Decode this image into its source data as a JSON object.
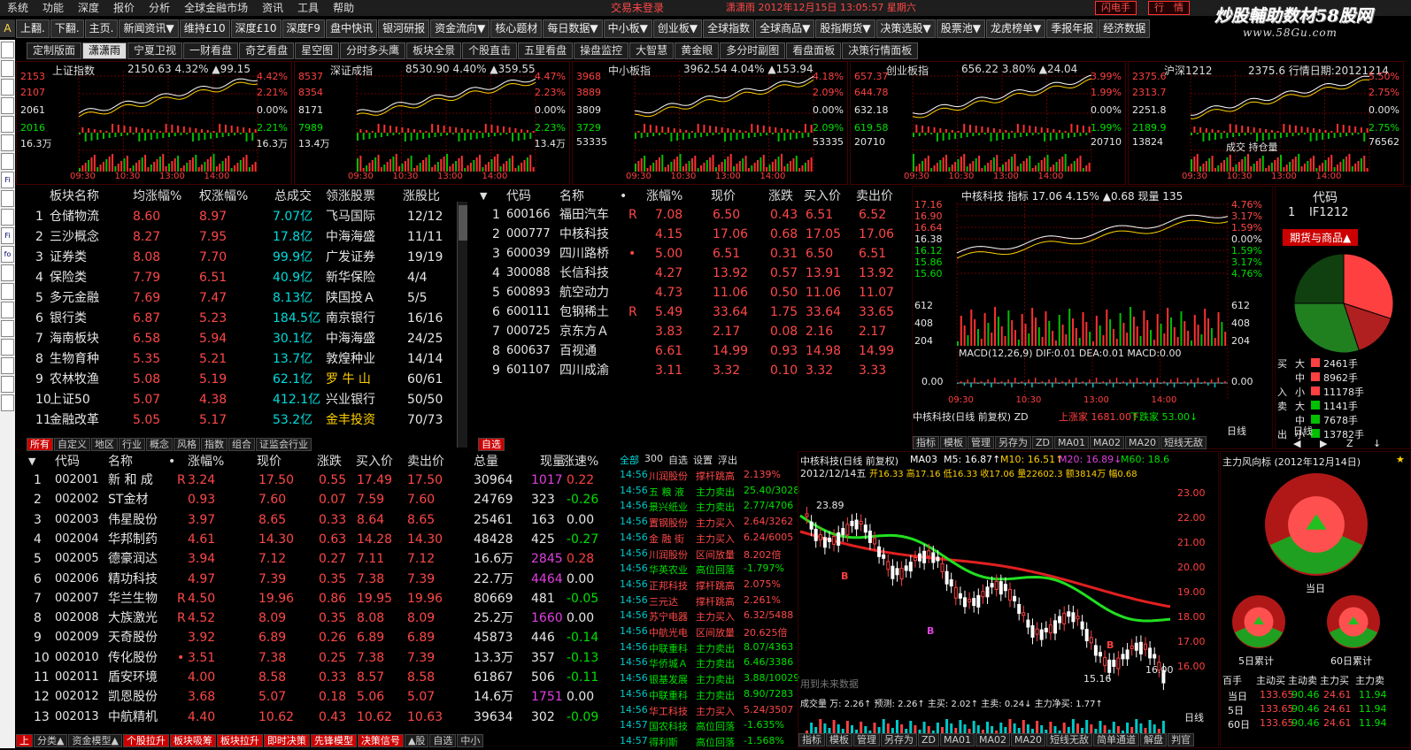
{
  "menu": [
    "系统",
    "功能",
    "深度",
    "报价",
    "分析",
    "全球金融市场",
    "资讯",
    "工具",
    "帮助"
  ],
  "status": {
    "trade": "交易未登录",
    "info": "潇潇雨  2012年12月15日  13:05:57  星期六"
  },
  "top_buttons": {
    "flash": "闪电手",
    "trade": "行　情"
  },
  "watermark": {
    "line1": "炒股輔助数材58股网",
    "line2": "www.58Gu.com"
  },
  "toolbar": [
    "上翻.",
    "下翻.",
    "主页.",
    "新闻资讯▼",
    "维持£10",
    "深度£10",
    "深度F9",
    "盘中快讯",
    "银河研报",
    "资金流向▼",
    "核心题材",
    "每日数据▼",
    "中小板▼",
    "创业板▼",
    "全球指数",
    "全球商品▼",
    "股指期货▼",
    "决策选股▼",
    "股票池▼",
    "龙虎榜单▼",
    "季报年报",
    "经济数据"
  ],
  "side_letter": "A",
  "side_tools": [
    "",
    "",
    "",
    "",
    "",
    "",
    "",
    "Fi",
    "",
    "",
    "Fi",
    "fo",
    "",
    "",
    "",
    "",
    "",
    "",
    "",
    ""
  ],
  "tabs": {
    "items": [
      "定制版面",
      "潇潇雨",
      "宁夏卫视",
      "一财看盘",
      "奇艺看盘",
      "星空图",
      "分时多头鹰",
      "板块全景",
      "个股直击",
      "五里看盘",
      "操盘监控",
      "大智慧",
      "黄金眼",
      "多分时副图",
      "看盘面板",
      "决策行情面板"
    ],
    "active": 1
  },
  "minis": [
    {
      "title": "上证指数",
      "head": "2150.63  4.32%  ▲99.15",
      "left": [
        "2153",
        "2107",
        "2061",
        "2016",
        "16.3万"
      ],
      "right": [
        "4.42%",
        "2.21%",
        "0.00%",
        "2.21%",
        "16.3万"
      ],
      "times": [
        "09:30",
        "10:30",
        "13:00",
        "14:00"
      ]
    },
    {
      "title": "深证成指",
      "head": "8530.90  4.40%  ▲359.55",
      "left": [
        "8537",
        "8354",
        "8171",
        "7989",
        "13.4万"
      ],
      "right": [
        "4.47%",
        "2.23%",
        "0.00%",
        "2.23%",
        "13.4万"
      ],
      "times": [
        "09:30",
        "10:30",
        "13:00",
        "14:00"
      ]
    },
    {
      "title": "中小板指",
      "head": "3962.54  4.04%  ▲153.94",
      "left": [
        "3968",
        "3889",
        "3809",
        "3729",
        "53335"
      ],
      "right": [
        "4.18%",
        "2.09%",
        "0.00%",
        "2.09%",
        "53335"
      ],
      "times": [
        "09:30",
        "10:30",
        "13:00",
        "14:00"
      ]
    },
    {
      "title": "创业板指",
      "head": "656.22  3.80%  ▲24.04",
      "left": [
        "657.37",
        "644.78",
        "632.18",
        "619.58",
        "20710"
      ],
      "right": [
        "3.99%",
        "1.99%",
        "0.00%",
        "1.99%",
        "20710"
      ],
      "times": [
        "09:30",
        "10:30",
        "13:00",
        "14:00"
      ]
    },
    {
      "title": "沪深1212",
      "head": "2375.6  行情日期:20121214",
      "left": [
        "2375.6",
        "2313.7",
        "2251.8",
        "2189.9",
        "13824"
      ],
      "right": [
        "5.50%",
        "2.75%",
        "0.00%",
        "2.75%",
        "76562"
      ],
      "times": [
        "09:30",
        "10:30",
        "13:00",
        "14:00"
      ],
      "extra": "成交  持仓量"
    }
  ],
  "sector_table": {
    "headers": [
      "板块名称",
      "均涨幅%",
      "权涨幅%",
      "总成交",
      "领涨股票",
      "涨股比"
    ],
    "rows": [
      [
        "1",
        "仓储物流",
        "8.60",
        "8.97",
        "7.07亿",
        "飞马国际",
        "12/12"
      ],
      [
        "2",
        "三沙概念",
        "8.27",
        "7.95",
        "17.8亿",
        "中海海盛",
        "11/11"
      ],
      [
        "3",
        "证券类",
        "8.08",
        "7.70",
        "99.9亿",
        "广发证券",
        "19/19"
      ],
      [
        "4",
        "保险类",
        "7.79",
        "6.51",
        "40.9亿",
        "新华保险",
        "4/4"
      ],
      [
        "5",
        "多元金融",
        "7.69",
        "7.47",
        "8.13亿",
        "陕国投Ａ",
        "5/5"
      ],
      [
        "6",
        "银行类",
        "6.87",
        "5.23",
        "184.5亿",
        "南京银行",
        "16/16"
      ],
      [
        "7",
        "海南板块",
        "6.58",
        "5.94",
        "30.1亿",
        "中海海盛",
        "24/25"
      ],
      [
        "8",
        "生物育种",
        "5.35",
        "5.21",
        "13.7亿",
        "敦煌种业",
        "14/14"
      ],
      [
        "9",
        "农林牧渔",
        "5.08",
        "5.19",
        "62.1亿",
        "罗 牛 山",
        "60/61"
      ],
      [
        "10",
        "上证50",
        "5.07",
        "4.38",
        "412.1亿",
        "兴业银行",
        "50/50"
      ],
      [
        "11",
        "金融改革",
        "5.05",
        "5.17",
        "53.2亿",
        "金丰投资",
        "70/73"
      ]
    ],
    "tabs": [
      "所有",
      "自定义",
      "地区",
      "行业",
      "概念",
      "风格",
      "指数",
      "组合",
      "证监会行业"
    ]
  },
  "watch_table": {
    "headers": [
      "代码",
      "名称",
      "•",
      "涨幅%",
      "现价",
      "涨跌",
      "买入价",
      "卖出价"
    ],
    "rows": [
      [
        "1",
        "600166",
        "福田汽车",
        "R",
        "7.08",
        "6.50",
        "0.43",
        "6.51",
        "6.52"
      ],
      [
        "2",
        "000777",
        "中核科技",
        "",
        "4.15",
        "17.06",
        "0.68",
        "17.05",
        "17.06"
      ],
      [
        "3",
        "600039",
        "四川路桥",
        "•",
        "5.00",
        "6.51",
        "0.31",
        "6.50",
        "6.51"
      ],
      [
        "4",
        "300088",
        "长信科技",
        "",
        "4.27",
        "13.92",
        "0.57",
        "13.91",
        "13.92"
      ],
      [
        "5",
        "600893",
        "航空动力",
        "",
        "4.73",
        "11.06",
        "0.50",
        "11.06",
        "11.07"
      ],
      [
        "6",
        "600111",
        "包钢稀土",
        "R",
        "5.49",
        "33.64",
        "1.75",
        "33.64",
        "33.65"
      ],
      [
        "7",
        "000725",
        "京东方Ａ",
        "",
        "3.83",
        "2.17",
        "0.08",
        "2.16",
        "2.17"
      ],
      [
        "8",
        "600637",
        "百视通",
        "",
        "6.61",
        "14.99",
        "0.93",
        "14.98",
        "14.99"
      ],
      [
        "9",
        "601107",
        "四川成渝",
        "",
        "3.11",
        "3.32",
        "0.10",
        "3.32",
        "3.33"
      ]
    ],
    "tab": "自选"
  },
  "intraday": {
    "head": "中核科技  指标  17.06  4.15%  ▲0.68  现量 135",
    "left": [
      "17.16",
      "16.90",
      "16.64",
      "16.38",
      "16.12",
      "15.86",
      "15.60",
      "612",
      "408",
      "204"
    ],
    "right": [
      "4.76%",
      "3.17%",
      "1.59%",
      "0.00%",
      "1.59%",
      "3.17%",
      "4.76%",
      "612",
      "408",
      "204"
    ],
    "macd": "MACD(12,26,9)  DIF:0.01  DEA:0.01  MACD:0.00",
    "macd_left": "0.00",
    "macd_right": "0.00",
    "times": [
      "09:30",
      "10:30",
      "13:00",
      "14:00"
    ],
    "foot": "中核科技(日线 前复权) ZD",
    "up": "上涨家  1681.00↑",
    "down": "下跌家  53.00↓",
    "daily": "日线",
    "tools": [
      "指标",
      "模板",
      "管理",
      "另存为",
      "ZD",
      "MA01",
      "MA02",
      "MA20",
      "短线无敌"
    ]
  },
  "futures": {
    "code_hdr": "代码",
    "row_no": "1",
    "row_code": "IF1212",
    "title": "期货与商品▲",
    "flows": [
      [
        "买",
        "大",
        "2461手"
      ],
      [
        "",
        "中",
        "8962手"
      ],
      [
        "入",
        "小",
        "11178手"
      ],
      [
        "卖",
        "大",
        "1141手"
      ],
      [
        "",
        "中",
        "7678手"
      ],
      [
        "出",
        "小",
        "13782手"
      ]
    ],
    "daily": "日线",
    "nav": [
      "◀",
      "▶",
      "Z",
      "↓"
    ]
  },
  "sme_table": {
    "headers": [
      "代码",
      "名称",
      "•",
      "涨幅%",
      "现价",
      "涨跌",
      "买入价",
      "卖出价",
      "总量",
      "现量",
      "涨速%"
    ],
    "rows": [
      [
        "1",
        "002001",
        "新 和 成",
        "R",
        "3.24",
        "17.50",
        "0.55",
        "17.49",
        "17.50",
        "30964",
        "1017",
        "0.22"
      ],
      [
        "2",
        "002002",
        "ST金材",
        "",
        "0.93",
        "7.60",
        "0.07",
        "7.59",
        "7.60",
        "24769",
        "323",
        "-0.26"
      ],
      [
        "3",
        "002003",
        "伟星股份",
        "",
        "3.97",
        "8.65",
        "0.33",
        "8.64",
        "8.65",
        "25461",
        "163",
        "0.00"
      ],
      [
        "4",
        "002004",
        "华邦制药",
        "",
        "4.61",
        "14.30",
        "0.63",
        "14.28",
        "14.30",
        "48428",
        "425",
        "-0.27"
      ],
      [
        "5",
        "002005",
        "德豪润达",
        "",
        "3.94",
        "7.12",
        "0.27",
        "7.11",
        "7.12",
        "16.6万",
        "2845",
        "0.28"
      ],
      [
        "6",
        "002006",
        "精功科技",
        "",
        "4.97",
        "7.39",
        "0.35",
        "7.38",
        "7.39",
        "22.7万",
        "4464",
        "0.00"
      ],
      [
        "7",
        "002007",
        "华兰生物",
        "R",
        "4.50",
        "19.96",
        "0.86",
        "19.95",
        "19.96",
        "80669",
        "481",
        "-0.05"
      ],
      [
        "8",
        "002008",
        "大族激光",
        "R",
        "4.52",
        "8.09",
        "0.35",
        "8.08",
        "8.09",
        "25.2万",
        "1660",
        "0.00"
      ],
      [
        "9",
        "002009",
        "天奇股份",
        "",
        "3.92",
        "6.89",
        "0.26",
        "6.89",
        "6.89",
        "45873",
        "446",
        "-0.14"
      ],
      [
        "10",
        "002010",
        "传化股份",
        "•",
        "3.51",
        "7.38",
        "0.25",
        "7.38",
        "7.39",
        "13.3万",
        "357",
        "-0.13"
      ],
      [
        "11",
        "002011",
        "盾安环境",
        "",
        "4.00",
        "8.58",
        "0.33",
        "8.57",
        "8.58",
        "61867",
        "506",
        "-0.11"
      ],
      [
        "12",
        "002012",
        "凯恩股份",
        "",
        "3.68",
        "5.07",
        "0.18",
        "5.06",
        "5.07",
        "14.6万",
        "1751",
        "0.00"
      ],
      [
        "13",
        "002013",
        "中航精机",
        "",
        "4.40",
        "10.62",
        "0.43",
        "10.62",
        "10.63",
        "39634",
        "302",
        "-0.09"
      ]
    ],
    "tabs": [
      "分类▲",
      "资金模型▲",
      "个股拉升",
      "板块吸筹",
      "板块拉升",
      "即时决策",
      "先锋模型",
      "决策信号",
      "▲股",
      "自选",
      "中小"
    ],
    "left_tab": "上"
  },
  "radar": {
    "header": [
      "全部",
      "300",
      "自选",
      "设置",
      "浮出"
    ],
    "rows": [
      [
        "14:56",
        "川润股份",
        "撑杆跳高",
        "2.139%"
      ],
      [
        "14:56",
        "五 粮 液",
        "主力卖出",
        "25.40/3028"
      ],
      [
        "14:56",
        "景兴纸业",
        "主力卖出",
        "2.77/4706"
      ],
      [
        "14:56",
        "置钢股份",
        "主力买入",
        "2.64/3262"
      ],
      [
        "14:56",
        "金 融 街",
        "主力买入",
        "6.24/6005"
      ],
      [
        "14:56",
        "川润股份",
        "区间放量",
        "8.202倍"
      ],
      [
        "14:56",
        "华英农业",
        "高位回落",
        "-1.797%"
      ],
      [
        "14:56",
        "正邦科技",
        "撑杆跳高",
        "2.075%"
      ],
      [
        "14:56",
        "三元达",
        "撑杆跳高",
        "2.261%"
      ],
      [
        "14:56",
        "苏宁电器",
        "主力买入",
        "6.32/5488"
      ],
      [
        "14:56",
        "中航光电",
        "区间放量",
        "20.625倍"
      ],
      [
        "14:56",
        "中联重科",
        "主力卖出",
        "8.07/4363"
      ],
      [
        "14:56",
        "华侨城Ａ",
        "主力卖出",
        "6.46/3386"
      ],
      [
        "14:56",
        "银基发展",
        "主力卖出",
        "3.88/10029"
      ],
      [
        "14:56",
        "中联重科",
        "主力卖出",
        "8.90/7283"
      ],
      [
        "14:56",
        "华工科技",
        "主力买入",
        "5.24/3507"
      ],
      [
        "14:57",
        "国农科技",
        "高位回落",
        "-1.635%"
      ],
      [
        "14:57",
        "得利斯",
        "高位回落",
        "-1.568%"
      ]
    ]
  },
  "kline": {
    "title": "中核科技(日线 前复权)",
    "ma": [
      "MA03",
      "M5: 16.87↑",
      "M10: 16.51↑",
      "M20: 16.89↓",
      "M60: 18.6"
    ],
    "date": "2012/12/14五",
    "ohlc": "开16.33  高17.16  低16.33  收17.06  量22602.3  额3814万  幅0.68",
    "right_axis": [
      "23.00",
      "22.00",
      "21.00",
      "20.00",
      "19.00",
      "18.00",
      "17.00",
      "16.00"
    ],
    "annot": [
      "23.89",
      "15.16",
      "16.00",
      "B",
      "B",
      "B"
    ],
    "vol": "成交量  万: 2.26↑  预测: 2.26↑  主买: 2.02↑  主卖: 0.24↓  主力净买: 1.77↑",
    "watermark": "用到未来数据",
    "tools": [
      "指标",
      "模板",
      "管理",
      "另存为",
      "ZD",
      "MA01",
      "MA02",
      "MA20",
      "短线无敌",
      "简单通道",
      "解盘",
      "判官"
    ],
    "daily": "日线"
  },
  "main_force": {
    "title": "主力风向标 (2012年12月14日)",
    "labels": [
      "当日",
      "5日累计",
      "60日累计"
    ],
    "table_hdr": [
      "百手",
      "主动买",
      "主动卖",
      "主力买",
      "主力卖"
    ],
    "table_rows": [
      [
        "当日",
        "133.65",
        "90.46",
        "24.61",
        "11.94"
      ],
      [
        "5日",
        "133.65",
        "90.46",
        "24.61",
        "11.94"
      ],
      [
        "60日",
        "133.65",
        "90.46",
        "24.61",
        "11.94"
      ]
    ]
  }
}
